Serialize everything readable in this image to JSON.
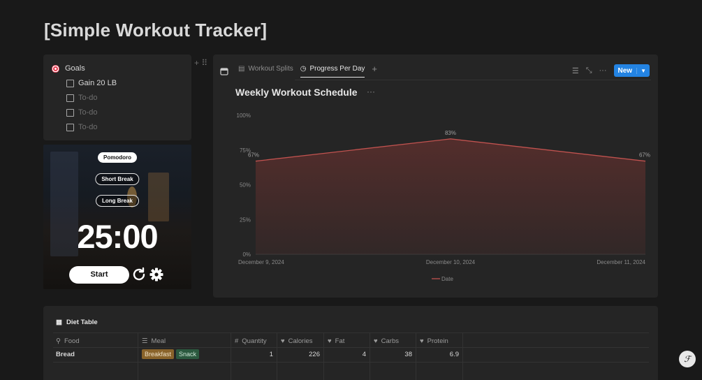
{
  "page": {
    "title": "[Simple Workout Tracker]"
  },
  "goals": {
    "title": "Goals",
    "items": [
      {
        "label": "Gain 20 LB",
        "done": false
      },
      {
        "label": "To-do",
        "done": false
      },
      {
        "label": "To-do",
        "done": false
      },
      {
        "label": "To-do",
        "done": false
      }
    ]
  },
  "pomodoro": {
    "modes": [
      "Pomodoro",
      "Short Break",
      "Long Break"
    ],
    "active_mode": "Pomodoro",
    "time": "25:00",
    "start_label": "Start"
  },
  "view": {
    "tabs": [
      {
        "label": "Workout Splits",
        "icon": "table-icon"
      },
      {
        "label": "Progress Per Day",
        "icon": "clock-icon",
        "active": true
      }
    ],
    "new_label": "New",
    "accent": "#2383e2"
  },
  "chart_data": {
    "type": "area",
    "title": "Weekly Workout Schedule",
    "categories": [
      "December 9, 2024",
      "December 10, 2024",
      "December 11, 2024"
    ],
    "series": [
      {
        "name": "Date",
        "values": [
          67,
          83,
          67
        ],
        "color": "#c0524f"
      }
    ],
    "value_labels": [
      "67%",
      "83%",
      "67%"
    ],
    "y_ticks": [
      "0%",
      "25%",
      "50%",
      "75%",
      "100%"
    ],
    "ylim": [
      0,
      100
    ],
    "legend": "bottom",
    "grid": false
  },
  "diet": {
    "title": "Diet Table",
    "columns": [
      {
        "label": "Food",
        "icon": "food-icon"
      },
      {
        "label": "Meal",
        "icon": "list-icon"
      },
      {
        "label": "Quantity",
        "icon": "hash-icon"
      },
      {
        "label": "Calories",
        "icon": "heart-icon"
      },
      {
        "label": "Fat",
        "icon": "heart-icon"
      },
      {
        "label": "Carbs",
        "icon": "heart-icon"
      },
      {
        "label": "Protein",
        "icon": "heart-icon"
      }
    ],
    "rows": [
      {
        "food": "Bread",
        "meal": [
          "Breakfast",
          "Snack"
        ],
        "quantity": "1",
        "calories": "226",
        "fat": "4",
        "carbs": "38",
        "protein": "6.9"
      }
    ],
    "tag_colors": {
      "Breakfast": "#89632a",
      "Snack": "#2b593f"
    }
  }
}
